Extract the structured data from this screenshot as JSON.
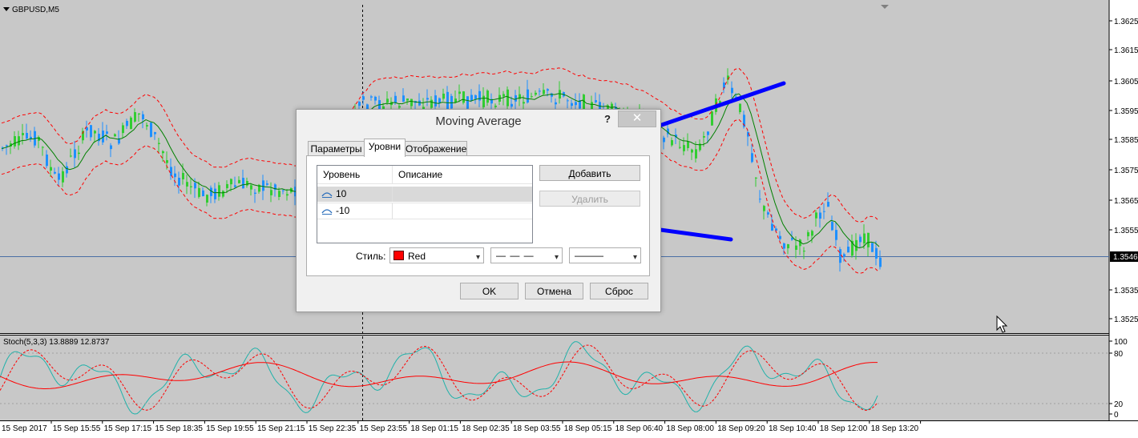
{
  "chart": {
    "symbol": "GBPUSD,M5",
    "stoch_label": "Stoch(5,3,3) 13.8889 12.8737",
    "price_labels": [
      "1.3625",
      "1.3615",
      "1.3605",
      "1.3595",
      "1.3585",
      "1.3575",
      "1.3565",
      "1.3555",
      "1.3535",
      "1.3525"
    ],
    "current_price": "1.3546",
    "stoch_levels": [
      "100",
      "80",
      "20",
      "0"
    ],
    "time_labels": [
      "15 Sep 2017",
      "15 Sep 15:55",
      "15 Sep 17:15",
      "15 Sep 18:35",
      "15 Sep 19:55",
      "15 Sep 21:15",
      "15 Sep 22:35",
      "15 Sep 23:55",
      "18 Sep 01:15",
      "18 Sep 02:35",
      "18 Sep 03:55",
      "18 Sep 05:15",
      "18 Sep 06:40",
      "18 Sep 08:00",
      "18 Sep 09:20",
      "18 Sep 10:40",
      "18 Sep 12:00",
      "18 Sep 13:20"
    ],
    "colors": {
      "bg": "#c8c8c8",
      "bull": "#32cd32",
      "bear": "#1e90ff",
      "ma": "#008000",
      "envelope": "#ff0000",
      "stoch_main": "#20b2aa",
      "stoch_signal": "#ff0000",
      "stoch_ma": "#ff0000",
      "arrow": "#0000ff"
    }
  },
  "dialog": {
    "title": "Moving Average",
    "help_label": "?",
    "close_label": "✕",
    "tabs": [
      {
        "label": "Параметры",
        "active": false
      },
      {
        "label": "Уровни",
        "active": true
      },
      {
        "label": "Отображение",
        "active": false
      }
    ],
    "list": {
      "headers": [
        "Уровень",
        "Описание"
      ],
      "rows": [
        {
          "level": "10",
          "description": "",
          "icon": "level-line-icon",
          "selected": true
        },
        {
          "level": "-10",
          "description": "",
          "icon": "level-line-icon",
          "selected": false
        }
      ]
    },
    "add_button": "Добавить",
    "delete_button": "Удалить",
    "style_label": "Стиль:",
    "color_value": "Red",
    "color_hex": "#ff0000",
    "line_style_value": "— — —",
    "line_width_value": "———",
    "ok_button": "OK",
    "cancel_button": "Отмена",
    "reset_button": "Сброс"
  }
}
